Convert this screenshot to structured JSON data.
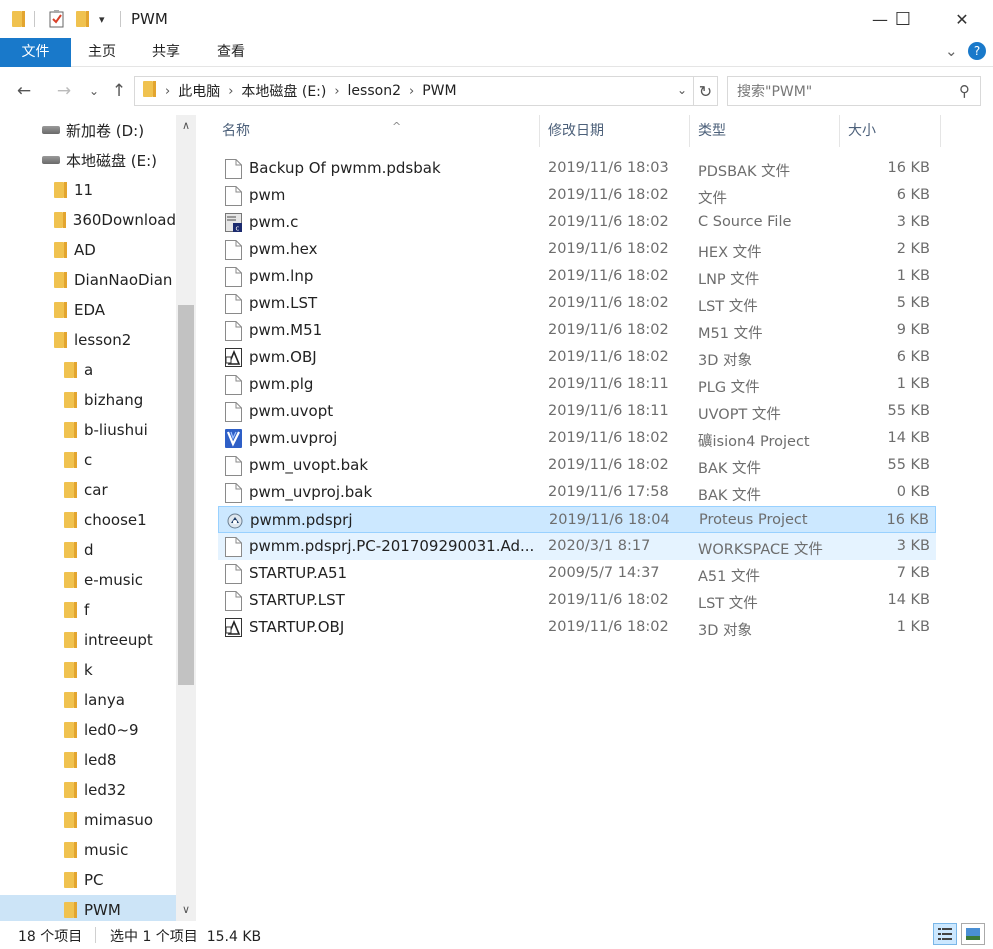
{
  "window": {
    "title": "PWM",
    "minimize_glyph": "—",
    "maximize_glyph": "☐",
    "close_glyph": "✕",
    "qat_dropdown_glyph": "▾"
  },
  "ribbon": {
    "tabs": [
      "文件",
      "主页",
      "共享",
      "查看"
    ],
    "expand_glyph": "⌄",
    "help_glyph": "?"
  },
  "nav": {
    "back_glyph": "←",
    "forward_glyph": "→",
    "recent_glyph": "⌄",
    "up_glyph": "↑",
    "breadcrumbs": [
      "此电脑",
      "本地磁盘 (E:)",
      "lesson2",
      "PWM"
    ],
    "crumb_sep": "›",
    "dropdown_glyph": "⌄",
    "refresh_glyph": "↻",
    "search_placeholder": "搜索\"PWM\"",
    "search_glyph": "⚲"
  },
  "sidebar": {
    "drives": [
      {
        "label": "新加卷 (D:)",
        "icon": "drive-icon"
      },
      {
        "label": "本地磁盘 (E:)",
        "icon": "drive-icon"
      }
    ],
    "folders_level1": [
      "11",
      "360Download",
      "AD",
      "DianNaoDian",
      "EDA",
      "lesson2"
    ],
    "folders_level2": [
      "a",
      "bizhang",
      "b-liushui",
      "c",
      "car",
      "choose1",
      "d",
      "e-music",
      "f",
      "intreeupt",
      "k",
      "lanya",
      "led0~9",
      "led8",
      "led32",
      "mimasuo",
      "music",
      "PC",
      "PWM"
    ],
    "selected": "PWM",
    "scroll_up_glyph": "∧",
    "scroll_down_glyph": "∨"
  },
  "columns": {
    "name": "名称",
    "date": "修改日期",
    "type": "类型",
    "size": "大小",
    "sort_glyph": "^"
  },
  "files": [
    {
      "name": "Backup Of pwmm.pdsbak",
      "date": "2019/11/6 18:03",
      "type": "PDSBAK 文件",
      "size": "16 KB",
      "icon": "document-icon"
    },
    {
      "name": "pwm",
      "date": "2019/11/6 18:02",
      "type": "文件",
      "size": "6 KB",
      "icon": "document-icon"
    },
    {
      "name": "pwm.c",
      "date": "2019/11/6 18:02",
      "type": "C Source File",
      "size": "3 KB",
      "icon": "c-source-icon"
    },
    {
      "name": "pwm.hex",
      "date": "2019/11/6 18:02",
      "type": "HEX 文件",
      "size": "2 KB",
      "icon": "document-icon"
    },
    {
      "name": "pwm.lnp",
      "date": "2019/11/6 18:02",
      "type": "LNP 文件",
      "size": "1 KB",
      "icon": "document-icon"
    },
    {
      "name": "pwm.LST",
      "date": "2019/11/6 18:02",
      "type": "LST 文件",
      "size": "5 KB",
      "icon": "document-icon"
    },
    {
      "name": "pwm.M51",
      "date": "2019/11/6 18:02",
      "type": "M51 文件",
      "size": "9 KB",
      "icon": "document-icon"
    },
    {
      "name": "pwm.OBJ",
      "date": "2019/11/6 18:02",
      "type": "3D 对象",
      "size": "6 KB",
      "icon": "3d-object-icon"
    },
    {
      "name": "pwm.plg",
      "date": "2019/11/6 18:11",
      "type": "PLG 文件",
      "size": "1 KB",
      "icon": "document-icon"
    },
    {
      "name": "pwm.uvopt",
      "date": "2019/11/6 18:11",
      "type": "UVOPT 文件",
      "size": "55 KB",
      "icon": "document-icon"
    },
    {
      "name": "pwm.uvproj",
      "date": "2019/11/6 18:02",
      "type": "礦ision4 Project",
      "size": "14 KB",
      "icon": "keil-project-icon"
    },
    {
      "name": "pwm_uvopt.bak",
      "date": "2019/11/6 18:02",
      "type": "BAK 文件",
      "size": "55 KB",
      "icon": "document-icon"
    },
    {
      "name": "pwm_uvproj.bak",
      "date": "2019/11/6 17:58",
      "type": "BAK 文件",
      "size": "0 KB",
      "icon": "document-icon"
    },
    {
      "name": "pwmm.pdsprj",
      "date": "2019/11/6 18:04",
      "type": "Proteus Project",
      "size": "16 KB",
      "icon": "proteus-icon",
      "state": "selected"
    },
    {
      "name": "pwmm.pdsprj.PC-201709290031.Ad...",
      "date": "2020/3/1 8:17",
      "type": "WORKSPACE 文件",
      "size": "3 KB",
      "icon": "document-icon",
      "state": "hover"
    },
    {
      "name": "STARTUP.A51",
      "date": "2009/5/7 14:37",
      "type": "A51 文件",
      "size": "7 KB",
      "icon": "document-icon"
    },
    {
      "name": "STARTUP.LST",
      "date": "2019/11/6 18:02",
      "type": "LST 文件",
      "size": "14 KB",
      "icon": "document-icon"
    },
    {
      "name": "STARTUP.OBJ",
      "date": "2019/11/6 18:02",
      "type": "3D 对象",
      "size": "1 KB",
      "icon": "3d-object-icon"
    }
  ],
  "status": {
    "item_count": "18 个项目",
    "selection": "选中 1 个项目  15.4 KB"
  },
  "colors": {
    "accent": "#1979ca",
    "selection_bg": "#cce8ff",
    "selection_border": "#99d1ff",
    "hover_bg": "#e5f3ff",
    "folder": "#f0c24f"
  }
}
